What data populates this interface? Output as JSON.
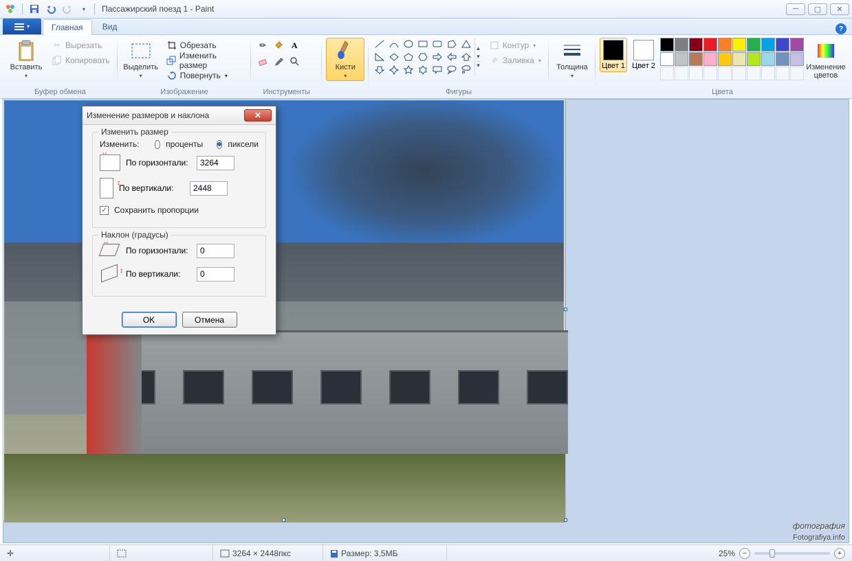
{
  "title": "Пассажирский поезд 1 - Paint",
  "tabs": {
    "file_menu": "",
    "main": "Главная",
    "view": "Вид"
  },
  "ribbon": {
    "clipboard": {
      "label": "Буфер обмена",
      "paste": "Вставить",
      "cut": "Вырезать",
      "copy": "Копировать"
    },
    "image": {
      "label": "Изображение",
      "select": "Выделить",
      "crop": "Обрезать",
      "resize": "Изменить размер",
      "rotate": "Повернуть"
    },
    "tools": {
      "label": "Инструменты"
    },
    "brushes": {
      "label": "Кисти",
      "btn": "Кисти"
    },
    "shapes": {
      "label": "Фигуры",
      "outline": "Контур",
      "fill": "Заливка"
    },
    "size": {
      "label": "Толщина",
      "btn": "Толщина"
    },
    "colors": {
      "label": "Цвета",
      "c1": "Цвет 1",
      "c2": "Цвет 2",
      "edit": "Изменение цветов",
      "palette_row1": [
        "#000000",
        "#7f7f7f",
        "#880015",
        "#ed1c24",
        "#ff7f27",
        "#fff200",
        "#22b14c",
        "#00a2e8",
        "#3f48cc",
        "#a349a4"
      ],
      "palette_row2": [
        "#ffffff",
        "#c3c3c3",
        "#b97a57",
        "#ffaec9",
        "#ffc90e",
        "#efe4b0",
        "#b5e61d",
        "#99d9ea",
        "#7092be",
        "#c8bfe7"
      ]
    }
  },
  "dialog": {
    "title": "Изменение размеров и наклона",
    "resize_legend": "Изменить размер",
    "by_label": "Изменить:",
    "percent": "проценты",
    "pixels": "пиксели",
    "horiz": "По горизонтали:",
    "vert": "По вертикали:",
    "h_val": "3264",
    "v_val": "2448",
    "keep_ratio": "Сохранить пропорции",
    "skew_legend": "Наклон (градусы)",
    "skew_h": "0",
    "skew_v": "0",
    "ok": "OK",
    "cancel": "Отмена"
  },
  "status": {
    "dims": "3264 × 2448пкс",
    "size_lbl": "Размер: 3,5МБ",
    "zoom": "25%"
  },
  "watermark": {
    "main": "фотография",
    "sub": "Fotografiya.info"
  }
}
